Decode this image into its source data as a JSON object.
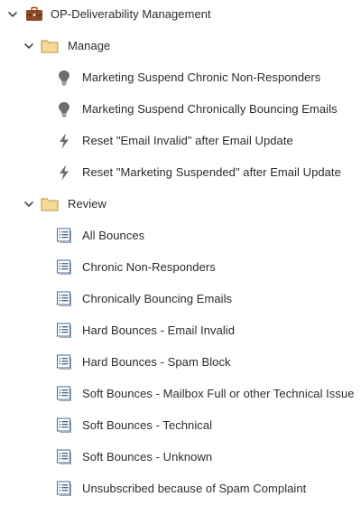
{
  "root": {
    "label": "OP-Deliverability Management",
    "icon": "briefcase-icon"
  },
  "folders": [
    {
      "label": "Manage",
      "icon": "folder-icon",
      "items": [
        {
          "label": "Marketing Suspend Chronic Non-Responders",
          "icon": "lightbulb-icon"
        },
        {
          "label": "Marketing Suspend Chronically Bouncing Emails",
          "icon": "lightbulb-icon"
        },
        {
          "label": "Reset \"Email Invalid\" after Email Update",
          "icon": "lightning-icon"
        },
        {
          "label": "Reset \"Marketing Suspended\" after Email Update",
          "icon": "lightning-icon"
        }
      ]
    },
    {
      "label": "Review",
      "icon": "folder-icon",
      "items": [
        {
          "label": "All Bounces",
          "icon": "list-icon"
        },
        {
          "label": "Chronic Non-Responders",
          "icon": "list-icon"
        },
        {
          "label": "Chronically Bouncing Emails",
          "icon": "list-icon"
        },
        {
          "label": "Hard Bounces - Email Invalid",
          "icon": "list-icon"
        },
        {
          "label": "Hard Bounces - Spam Block",
          "icon": "list-icon"
        },
        {
          "label": "Soft Bounces - Mailbox Full or other Technical Issue",
          "icon": "list-icon"
        },
        {
          "label": "Soft Bounces - Technical",
          "icon": "list-icon"
        },
        {
          "label": "Soft Bounces - Unknown",
          "icon": "list-icon"
        },
        {
          "label": "Unsubscribed because of Spam Complaint",
          "icon": "list-icon"
        }
      ]
    }
  ],
  "colors": {
    "text": "#2c2c2c",
    "chevron": "#4b4b4b",
    "icon_gray": "#6e6e6e",
    "folder_fill": "#f5d999",
    "folder_stroke": "#b8933f",
    "briefcase": "#8a4a26",
    "list_icon_stroke": "#4a6a8a"
  }
}
